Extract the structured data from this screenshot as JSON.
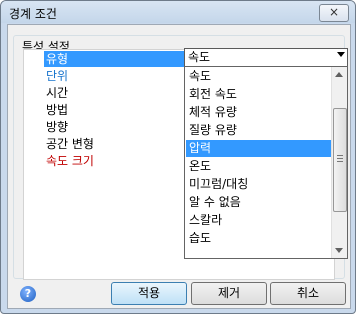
{
  "window": {
    "title": "경계 조건",
    "close_label": "×"
  },
  "group": {
    "label": "특성 설정"
  },
  "properties": [
    {
      "label": "유형"
    },
    {
      "label": "단위"
    },
    {
      "label": "시간"
    },
    {
      "label": "방법"
    },
    {
      "label": "방향"
    },
    {
      "label": "공간 변형"
    },
    {
      "label": "속도 크기"
    }
  ],
  "combo": {
    "value": "속도"
  },
  "dropdown": {
    "options": [
      "속도",
      "회전 속도",
      "체적 유량",
      "질량 유량",
      "압력",
      "온도",
      "미끄럼/대칭",
      "알 수 없음",
      "스칼라",
      "습도"
    ],
    "selected_index": 4
  },
  "buttons": {
    "apply": "적용",
    "remove": "제거",
    "cancel": "취소"
  },
  "help": {
    "glyph": "?"
  },
  "colors": {
    "selection": "#3399ff",
    "blue_label": "#1874cd",
    "red_label": "#c00000"
  }
}
